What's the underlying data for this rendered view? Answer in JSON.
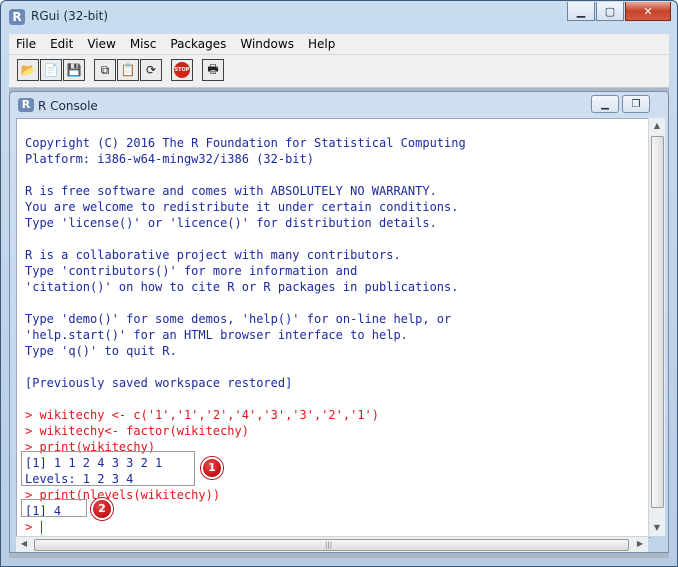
{
  "window": {
    "title": "RGui (32-bit)",
    "app_icon": "R"
  },
  "menubar": [
    "File",
    "Edit",
    "View",
    "Misc",
    "Packages",
    "Windows",
    "Help"
  ],
  "toolbar": {
    "icons": [
      "open-script-icon",
      "load-workspace-icon",
      "save-workspace-icon",
      "copy-icon",
      "paste-icon",
      "copy-paste-icon",
      "stop-icon",
      "print-icon"
    ],
    "stop_label": "STOP"
  },
  "console": {
    "title": "R Console",
    "icon": "R",
    "lines": [
      {
        "text": "",
        "color": "blue"
      },
      {
        "text": "Copyright (C) 2016 The R Foundation for Statistical Computing",
        "color": "blue"
      },
      {
        "text": "Platform: i386-w64-mingw32/i386 (32-bit)",
        "color": "blue"
      },
      {
        "text": "",
        "color": "blue"
      },
      {
        "text": "R is free software and comes with ABSOLUTELY NO WARRANTY.",
        "color": "blue"
      },
      {
        "text": "You are welcome to redistribute it under certain conditions.",
        "color": "blue"
      },
      {
        "text": "Type 'license()' or 'licence()' for distribution details.",
        "color": "blue"
      },
      {
        "text": "",
        "color": "blue"
      },
      {
        "text": "R is a collaborative project with many contributors.",
        "color": "blue"
      },
      {
        "text": "Type 'contributors()' for more information and",
        "color": "blue"
      },
      {
        "text": "'citation()' on how to cite R or R packages in publications.",
        "color": "blue"
      },
      {
        "text": "",
        "color": "blue"
      },
      {
        "text": "Type 'demo()' for some demos, 'help()' for on-line help, or",
        "color": "blue"
      },
      {
        "text": "'help.start()' for an HTML browser interface to help.",
        "color": "blue"
      },
      {
        "text": "Type 'q()' to quit R.",
        "color": "blue"
      },
      {
        "text": "",
        "color": "blue"
      },
      {
        "text": "[Previously saved workspace restored]",
        "color": "blue"
      },
      {
        "text": "",
        "color": "blue"
      },
      {
        "text": "> wikitechy <- c('1','1','2','4','3','3','2','1')",
        "color": "red"
      },
      {
        "text": "> wikitechy<- factor(wikitechy)",
        "color": "red"
      },
      {
        "text": "> print(wikitechy)",
        "color": "red"
      },
      {
        "text": "[1] 1 1 2 4 3 3 2 1",
        "color": "blue"
      },
      {
        "text": "Levels: 1 2 3 4",
        "color": "blue"
      },
      {
        "text": "> print(nlevels(wikitechy))",
        "color": "red"
      },
      {
        "text": "[1] 4",
        "color": "blue"
      },
      {
        "text": ">",
        "color": "red"
      }
    ],
    "badges": [
      "1",
      "2"
    ]
  }
}
